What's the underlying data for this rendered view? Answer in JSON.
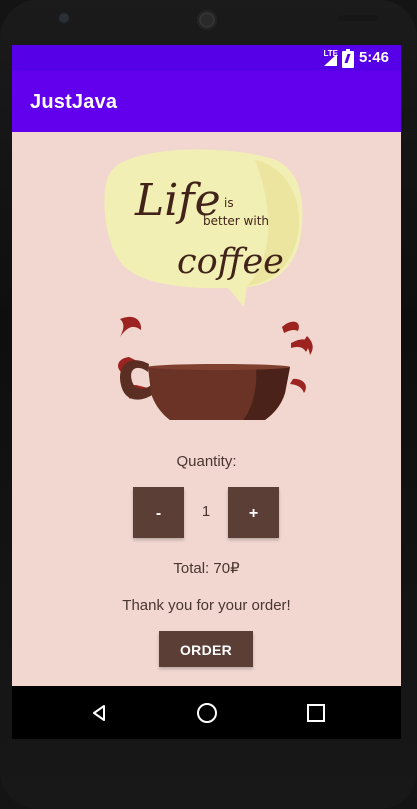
{
  "status_bar": {
    "network": "LTE",
    "time": "5:46"
  },
  "app_bar": {
    "title": "JustJava"
  },
  "illustration": {
    "text_line1": "Life",
    "text_line2": "is",
    "text_line3": "better with",
    "text_line4": "coffee"
  },
  "order": {
    "quantity_label": "Quantity:",
    "minus_label": "-",
    "quantity_value": "1",
    "plus_label": "+",
    "total_label": "Total: 70₽",
    "thank_you_label": "Thank you for your order!",
    "order_button_label": "ORDER"
  },
  "navigation": {
    "icons": [
      "back-icon",
      "home-icon",
      "overview-icon"
    ]
  },
  "colors": {
    "status_bar": "#5600e8",
    "app_bar": "#6200ee",
    "screen_background": "#f1d7d0",
    "button": "#5b3f37"
  }
}
